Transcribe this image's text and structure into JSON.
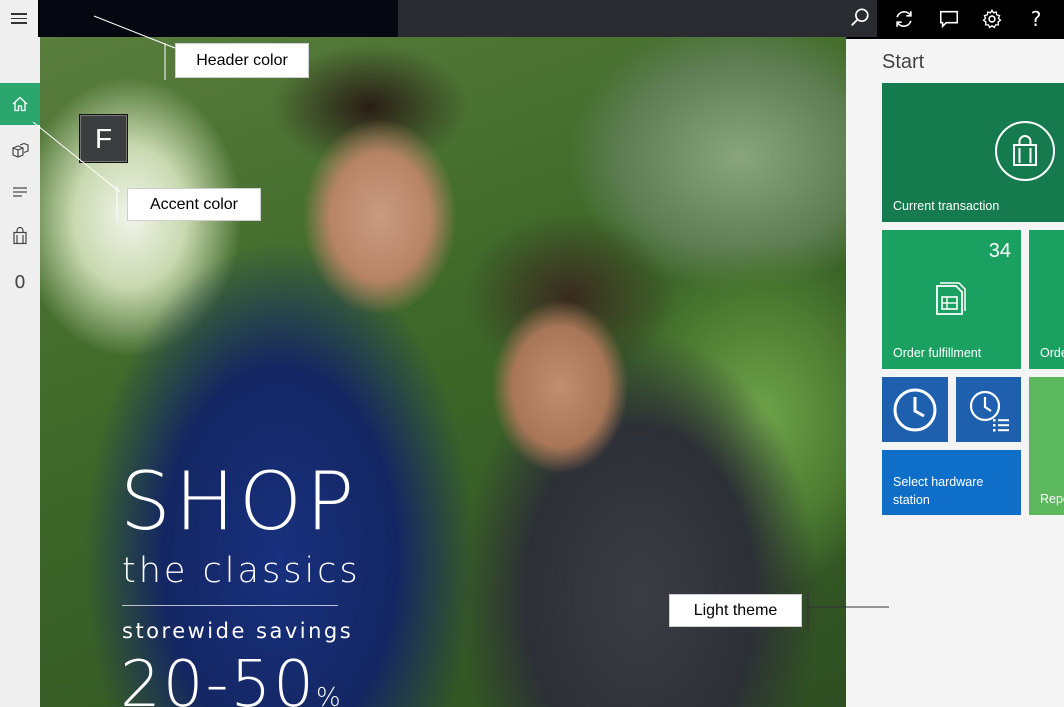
{
  "header": {
    "search_placeholder": "",
    "icons": [
      "menu-icon",
      "search-icon",
      "refresh-icon",
      "comment-icon",
      "settings-icon",
      "help-icon"
    ],
    "help_label": "?"
  },
  "leftnav": {
    "items": [
      "home-icon",
      "products-icon",
      "list-icon",
      "bag-icon"
    ],
    "cart_count": "0"
  },
  "hero": {
    "line1": "SHOP",
    "line2": "the classics",
    "line3": "storewide savings",
    "line4": "20-50",
    "line4_suffix": "%"
  },
  "start": {
    "title": "Start",
    "tiles": {
      "current_transaction": "Current transaction",
      "order_fulfillment": "Order fulfillment",
      "order_fulfillment_count": "34",
      "order_partial": "Orde",
      "select_hardware": "Select hardware station",
      "report_partial": "Repo"
    }
  },
  "accent_tile_letter": "F",
  "callouts": {
    "header_color": "Header color",
    "accent_color": "Accent color",
    "light_theme": "Light theme"
  },
  "colors": {
    "accent": "#2ca66f",
    "header": "#000000",
    "tile_green_dark": "#157b4f",
    "tile_green": "#1aa060",
    "tile_blue": "#1e5fae",
    "tile_blue_light": "#0f6fc8",
    "tile_green_light": "#5cb85c"
  }
}
